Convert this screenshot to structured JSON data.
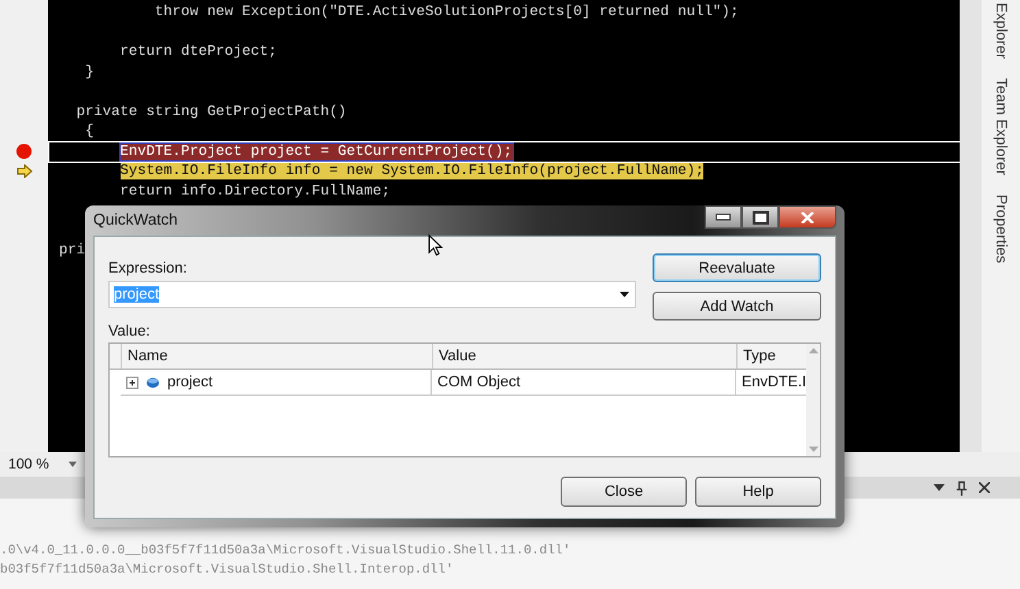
{
  "editor": {
    "lines": [
      {
        "kind": "code",
        "text": "           throw new Exception(\"DTE.ActiveSolutionProjects[0] returned null\");"
      },
      {
        "kind": "blank"
      },
      {
        "kind": "code",
        "text": "       return dteProject;"
      },
      {
        "kind": "code",
        "text": "   }"
      },
      {
        "kind": "blank"
      },
      {
        "kind": "code",
        "text": "  private string GetProjectPath()"
      },
      {
        "kind": "code",
        "text": "   {"
      },
      {
        "kind": "breakpoint",
        "text": "EnvDTE.Project project = GetCurrentProject();"
      },
      {
        "kind": "current",
        "text": "System.IO.FileInfo info = new System.IO.FileInfo(project.FullName);"
      },
      {
        "kind": "code",
        "text": "       return info.Directory.FullName;"
      },
      {
        "kind": "blank"
      },
      {
        "kind": "blank"
      },
      {
        "kind": "code",
        "text": "pri"
      }
    ],
    "zoom": "100 %"
  },
  "side_tabs": [
    {
      "label": "Explorer"
    },
    {
      "label": "Team Explorer"
    },
    {
      "label": "Properties"
    }
  ],
  "output": {
    "lines": [
      ".0\\v4.0_11.0.0.0__b03f5f7f11d50a3a\\Microsoft.VisualStudio.Shell.11.0.dll'",
      "b03f5f7f11d50a3a\\Microsoft.VisualStudio.Shell.Interop.dll'"
    ]
  },
  "dialog": {
    "title": "QuickWatch",
    "expression_label": "Expression:",
    "expression": {
      "value": "project",
      "selected": true
    },
    "value_label": "Value:",
    "columns": [
      "Name",
      "Value",
      "Type"
    ],
    "rows": [
      {
        "name": "project",
        "value": "COM Object",
        "type": "EnvDTE.I",
        "expanded": false
      }
    ],
    "buttons": [
      {
        "label": "Reevaluate",
        "focused": true
      },
      {
        "label": "Add Watch",
        "focused": false
      }
    ],
    "footer_buttons": [
      "Close",
      "Help"
    ]
  }
}
